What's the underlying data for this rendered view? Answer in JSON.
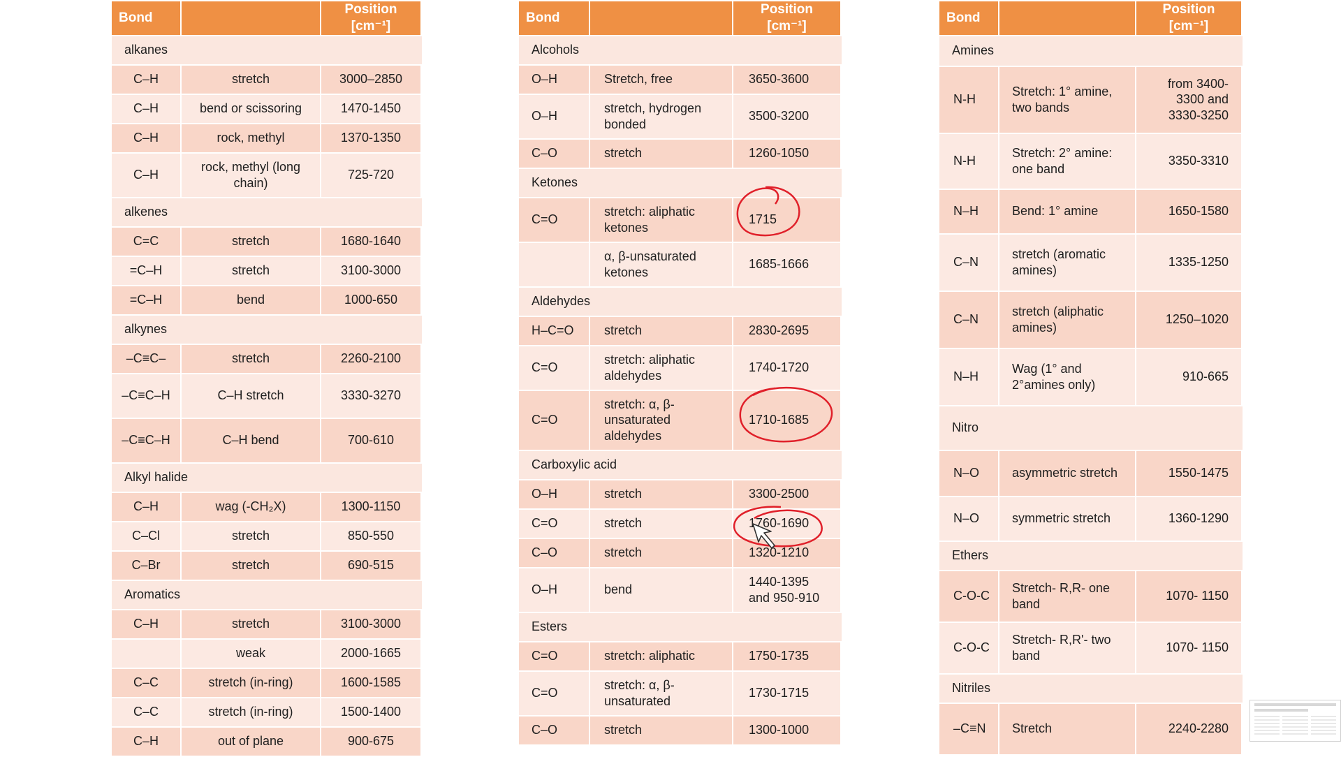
{
  "header": {
    "bond": "Bond",
    "group": "",
    "position": "Position [cm⁻¹]"
  },
  "table1": [
    {
      "group": "alkanes"
    },
    {
      "bond": "C–H",
      "desc": "stretch",
      "pos": "3000–2850"
    },
    {
      "bond": "C–H",
      "desc": "bend or scissoring",
      "pos": "1470-1450"
    },
    {
      "bond": "C–H",
      "desc": "rock, methyl",
      "pos": "1370-1350"
    },
    {
      "bond": "C–H",
      "desc": "rock, methyl (long chain)",
      "pos": "725-720"
    },
    {
      "group": "alkenes"
    },
    {
      "bond": "C=C",
      "desc": "stretch",
      "pos": "1680-1640"
    },
    {
      "bond": "=C–H",
      "desc": "stretch",
      "pos": "3100-3000"
    },
    {
      "bond": "=C–H",
      "desc": "bend",
      "pos": "1000-650"
    },
    {
      "group": "alkynes"
    },
    {
      "bond": "–C≡C–",
      "desc": "stretch",
      "pos": "2260-2100"
    },
    {
      "bond": "–C≡C–H",
      "desc": "C–H stretch",
      "pos": "3330-3270"
    },
    {
      "bond": "–C≡C–H",
      "desc": "C–H bend",
      "pos": "700-610"
    },
    {
      "group": "Alkyl halide"
    },
    {
      "bond": "C–H",
      "desc": "wag (-CH₂X)",
      "pos": "1300-1150"
    },
    {
      "bond": "C–Cl",
      "desc": "stretch",
      "pos": "850-550"
    },
    {
      "bond": "C–Br",
      "desc": "stretch",
      "pos": "690-515"
    },
    {
      "group": "Aromatics"
    },
    {
      "bond": "C–H",
      "desc": "stretch",
      "pos": "3100-3000"
    },
    {
      "bond": "",
      "desc": "weak",
      "pos": "2000-1665"
    },
    {
      "bond": "C–C",
      "desc": "stretch (in-ring)",
      "pos": "1600-1585"
    },
    {
      "bond": "C–C",
      "desc": "stretch (in-ring)",
      "pos": "1500-1400"
    },
    {
      "bond": "C–H",
      "desc": "out of plane",
      "pos": "900-675"
    }
  ],
  "table2": [
    {
      "group": "Alcohols"
    },
    {
      "bond": "O–H",
      "desc": "Stretch, free",
      "pos": "3650-3600"
    },
    {
      "bond": "O–H",
      "desc": "stretch, hydrogen bonded",
      "pos": "3500-3200"
    },
    {
      "bond": "C–O",
      "desc": "stretch",
      "pos": "1260-1050"
    },
    {
      "group": "Ketones"
    },
    {
      "bond": "C=O",
      "desc": "stretch: aliphatic ketones",
      "pos": "1715"
    },
    {
      "bond": "",
      "desc": "α, β-unsaturated ketones",
      "pos": "1685-1666"
    },
    {
      "group": "Aldehydes"
    },
    {
      "bond": "H–C=O",
      "desc": "stretch",
      "pos": "2830-2695"
    },
    {
      "bond": "C=O",
      "desc": "stretch: aliphatic aldehydes",
      "pos": "1740-1720"
    },
    {
      "bond": "C=O",
      "desc": "stretch: α, β-unsaturated aldehydes",
      "pos": "1710-1685"
    },
    {
      "group": "Carboxylic acid"
    },
    {
      "bond": "O–H",
      "desc": "stretch",
      "pos": "3300-2500"
    },
    {
      "bond": "C=O",
      "desc": "stretch",
      "pos": "1760-1690"
    },
    {
      "bond": "C–O",
      "desc": "stretch",
      "pos": "1320-1210"
    },
    {
      "bond": "O–H",
      "desc": "bend",
      "pos": "1440-1395 and 950-910"
    },
    {
      "group": "Esters"
    },
    {
      "bond": "C=O",
      "desc": "stretch: aliphatic",
      "pos": "1750-1735"
    },
    {
      "bond": "C=O",
      "desc": "stretch: α, β-unsaturated",
      "pos": "1730-1715"
    },
    {
      "bond": "C–O",
      "desc": "stretch",
      "pos": "1300-1000"
    }
  ],
  "table3": [
    {
      "group": "Amines"
    },
    {
      "bond": "N-H",
      "desc": "Stretch: 1° amine, two bands",
      "pos": "from 3400-3300 and 3330-3250"
    },
    {
      "bond": "N-H",
      "desc": "Stretch: 2° amine: one band",
      "pos": "3350-3310"
    },
    {
      "bond": "N–H",
      "desc": "Bend:  1° amine",
      "pos": "1650-1580"
    },
    {
      "bond": "C–N",
      "desc": "stretch (aromatic amines)",
      "pos": "1335-1250"
    },
    {
      "bond": "C–N",
      "desc": "stretch (aliphatic amines)",
      "pos": "1250–1020"
    },
    {
      "bond": "N–H",
      "desc": "Wag (1° and 2°amines only)",
      "pos": "910-665"
    },
    {
      "group": "Nitro"
    },
    {
      "bond": "N–O",
      "desc": "asymmetric stretch",
      "pos": "1550-1475"
    },
    {
      "bond": "N–O",
      "desc": "symmetric stretch",
      "pos": "1360-1290"
    },
    {
      "group": "Ethers"
    },
    {
      "bond": "C-O-C",
      "desc": "Stretch- R,R- one band",
      "pos": "1070- 1150"
    },
    {
      "bond": "C-O-C",
      "desc": "Stretch- R,R'- two band",
      "pos": "1070- 1150"
    },
    {
      "group": "Nitriles"
    },
    {
      "bond": "–C≡N",
      "desc": "Stretch",
      "pos": "2240-2280"
    }
  ],
  "annotation_color": "#e0202a",
  "accent_color": "#ef9044"
}
